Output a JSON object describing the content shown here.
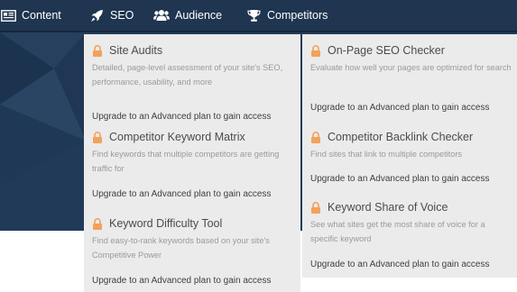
{
  "nav": {
    "items": [
      {
        "label": "Content",
        "icon": "newspaper-icon"
      },
      {
        "label": "SEO",
        "icon": "rocket-icon"
      },
      {
        "label": "Audience",
        "icon": "users-icon"
      },
      {
        "label": "Competitors",
        "icon": "trophy-icon"
      }
    ]
  },
  "colors": {
    "nav_bg": "#1f3550",
    "panel_bg": "#ebebeb",
    "lock": "#f2a25a"
  },
  "menu": {
    "left": [
      {
        "title": "Site Audits",
        "description": "Detailed, page-level assessment of your site's SEO, performance, usability, and more",
        "link": "Upgrade to an Advanced plan to gain access"
      },
      {
        "title": "Competitor Keyword Matrix",
        "description": "Find keywords that multiple competitors are getting traffic for",
        "link": "Upgrade to an Advanced plan to gain access"
      },
      {
        "title": "Keyword Difficulty Tool",
        "description": "Find easy-to-rank keywords based on your site's Competitive Power",
        "link": "Upgrade to an Advanced plan to gain access"
      }
    ],
    "right": [
      {
        "title": "On-Page SEO Checker",
        "description": "Evaluate how well your pages are optimized for search",
        "link": "Upgrade to an Advanced plan to gain access"
      },
      {
        "title": "Competitor Backlink Checker",
        "description": "Find sites that link to multiple competitors",
        "link": "Upgrade to an Advanced plan to gain access"
      },
      {
        "title": "Keyword Share of Voice",
        "description": "See what sites get the most share of voice for a specific keyword",
        "link": "Upgrade to an Advanced plan to gain access"
      }
    ]
  }
}
